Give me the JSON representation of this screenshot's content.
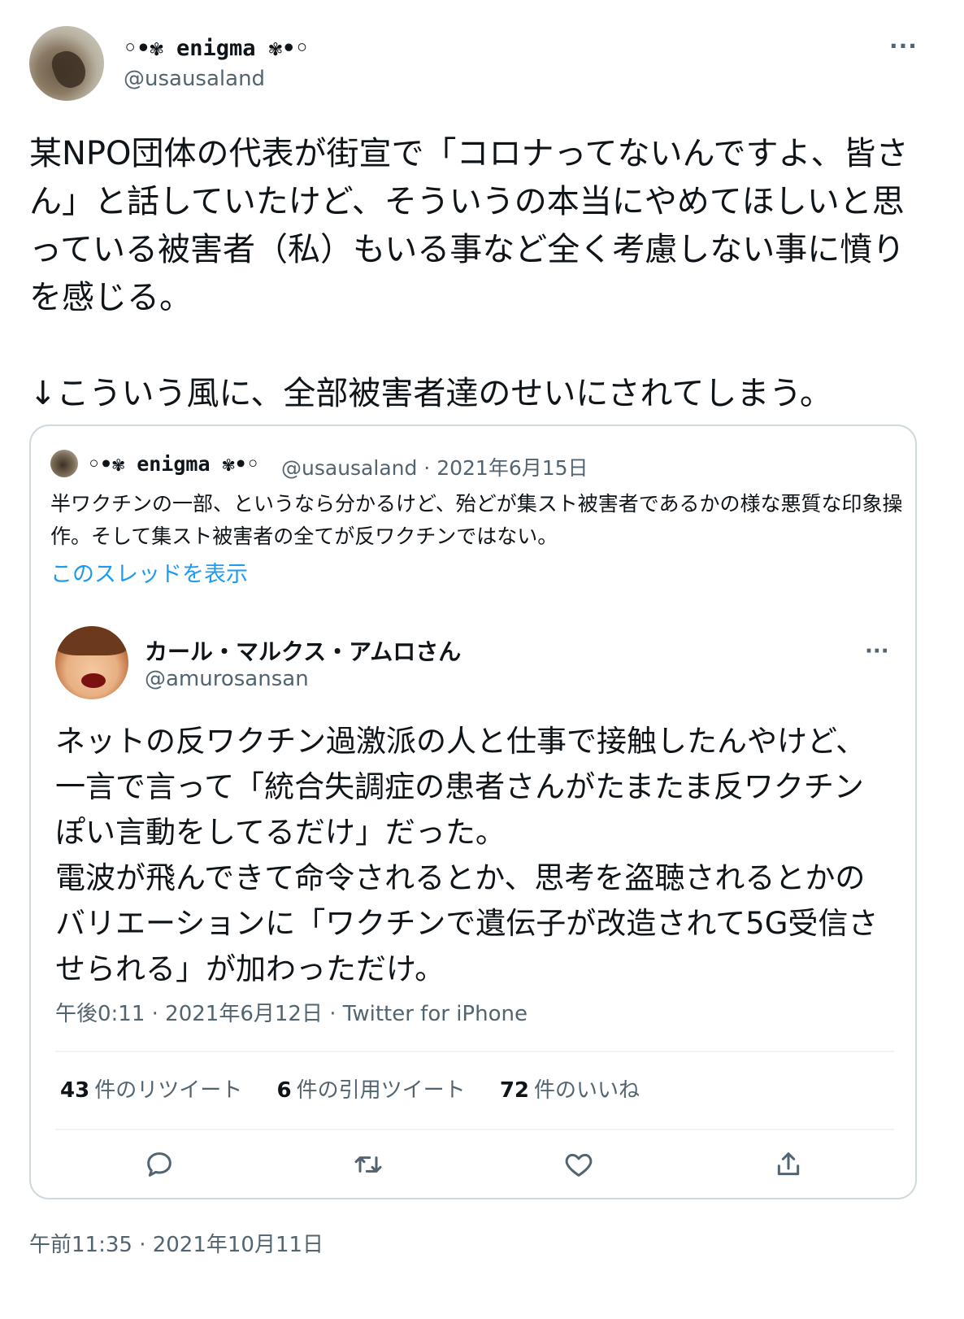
{
  "tweet": {
    "display_name": "◦•✾ enigma ✾•◦",
    "handle": "@usausaland",
    "more_icon": "more-horizontal-icon",
    "text": "某NPO団体の代表が街宣で「コロナってないんですよ、皆さん」と話していたけど、そういうの本当にやめてほしいと思っている被害者（私）もいる事など全く考慮しない事に憤りを感じる。\n\n↓こういう風に、全部被害者達のせいにされてしまう。",
    "timestamp": "午前11:35 · 2021年10月11日"
  },
  "quote": {
    "display_name": "◦•✾ enigma ✾•◦",
    "meta": "@usausaland · 2021年6月15日",
    "text": "半ワクチンの一部、というなら分かるけど、殆どが集スト被害者であるかの様な悪質な印象操作。そして集スト被害者の全てが反ワクチンではない。",
    "thread_link": "このスレッドを表示"
  },
  "inner": {
    "display_name": "カール・マルクス・アムロさん",
    "handle": "@amurosansan",
    "text": "ネットの反ワクチン過激派の人と仕事で接触したんやけど、一言で言って「統合失調症の患者さんがたまたま反ワクチンぽい言動をしてるだけ」だった。\n電波が飛んできて命令されるとか、思考を盗聴されるとかのバリエーションに「ワクチンで遺伝子が改造されて5G受信させられる」が加わっただけ。",
    "meta": "午後0:11 · 2021年6月12日 · Twitter for iPhone",
    "stats": {
      "retweets_count": "43",
      "retweets_label": "件のリツイート",
      "quotes_count": "6",
      "quotes_label": "件の引用ツイート",
      "likes_count": "72",
      "likes_label": "件のいいね"
    },
    "actions": [
      "reply-icon",
      "retweet-icon",
      "like-icon",
      "share-icon"
    ]
  },
  "colors": {
    "text": "#0f1419",
    "secondary": "#536471",
    "link": "#1d9bf0",
    "border": "#cfd9de"
  }
}
